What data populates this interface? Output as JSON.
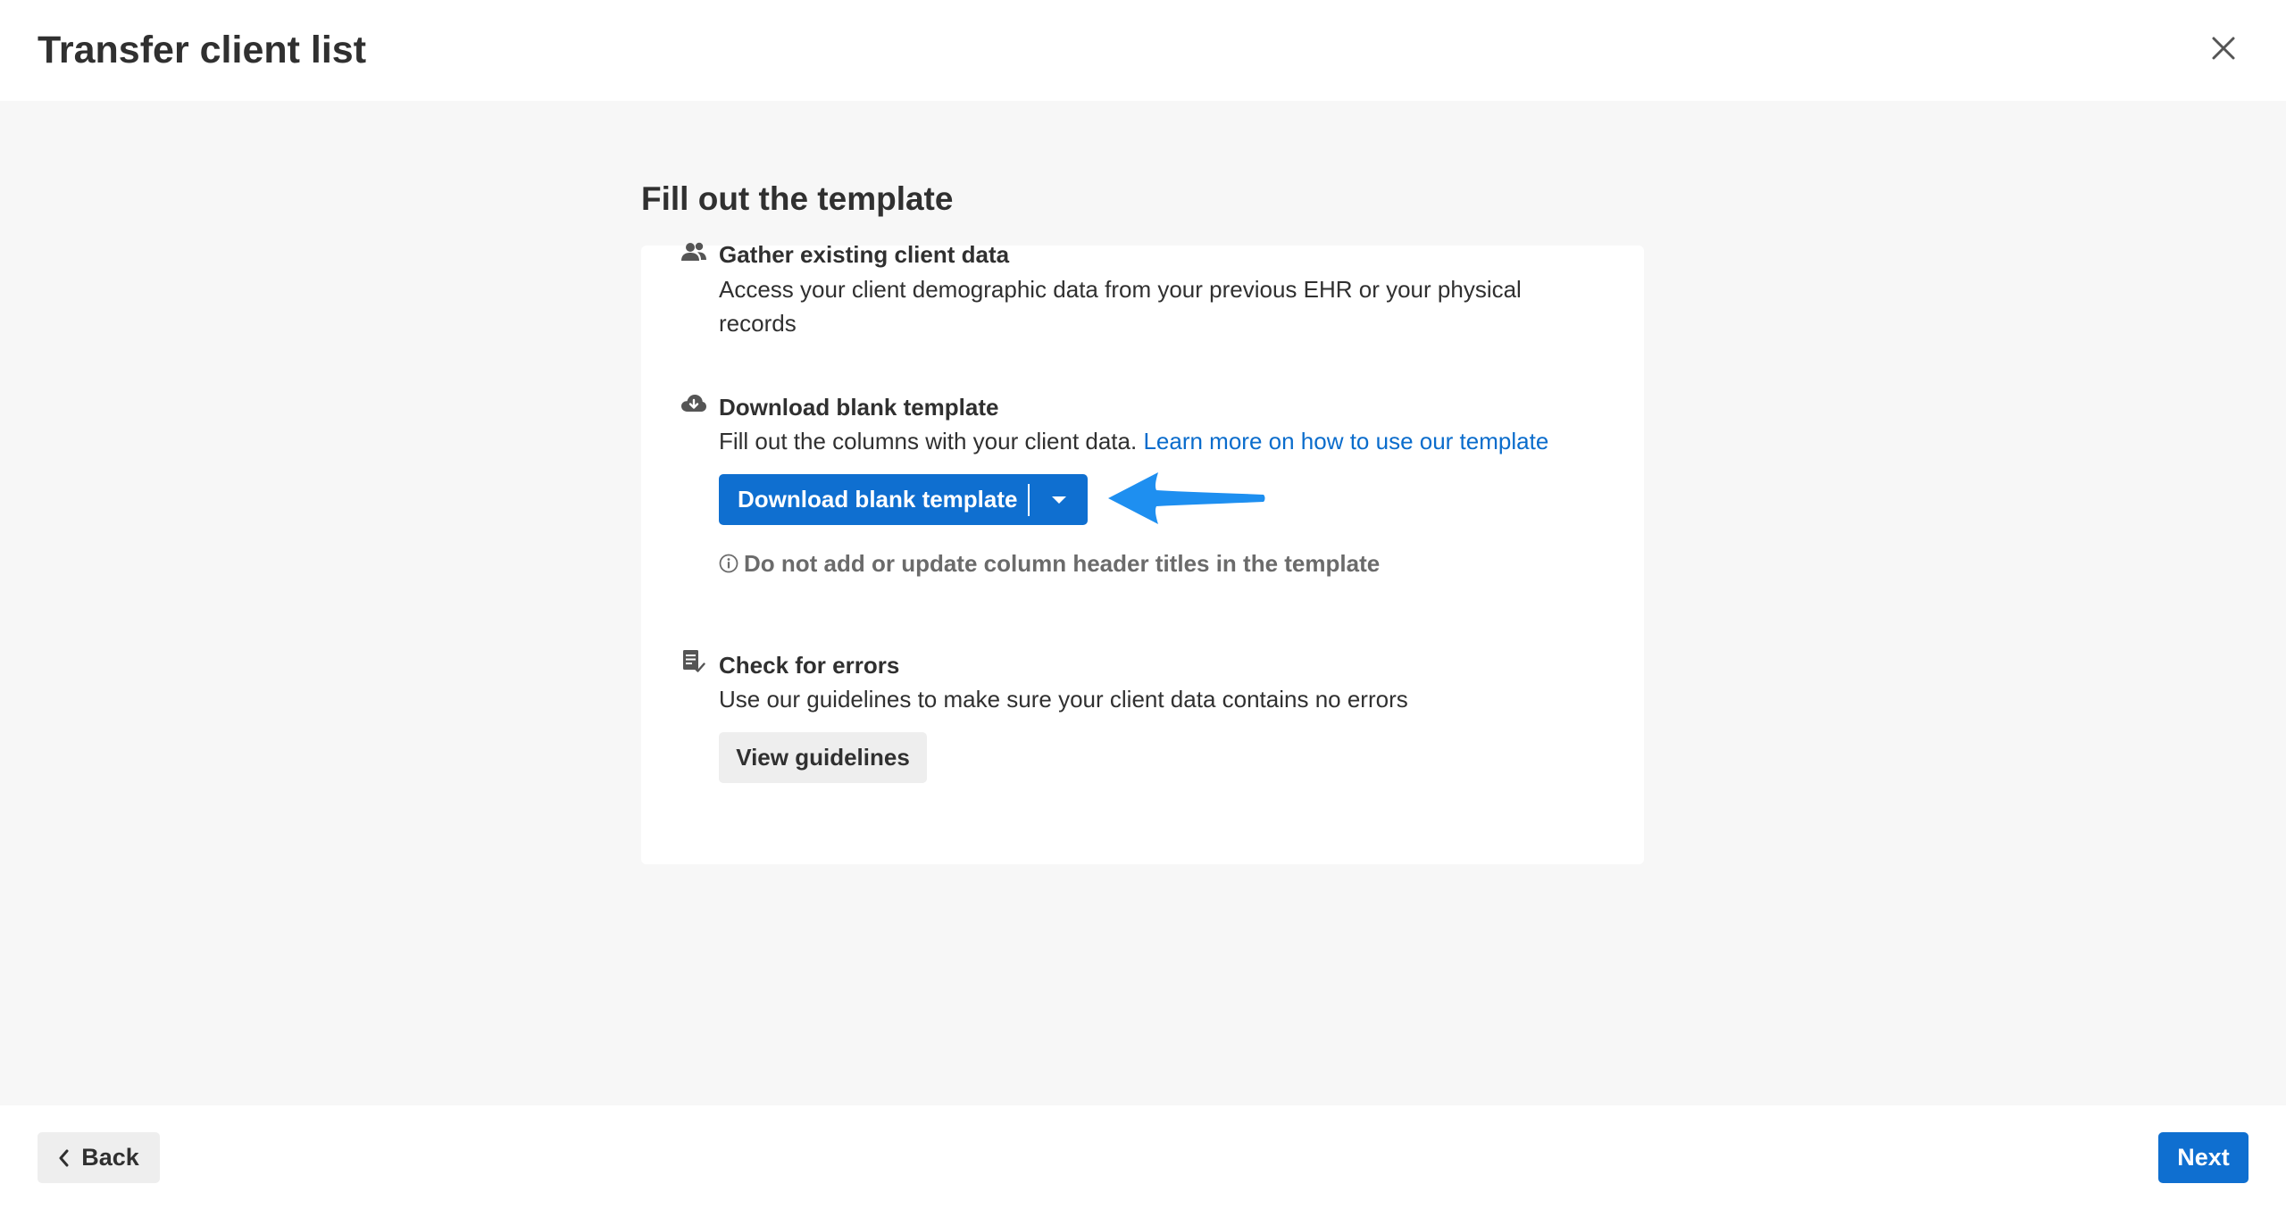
{
  "header": {
    "title": "Transfer client list",
    "close_icon": "close-icon"
  },
  "main": {
    "section_title": "Fill out the template",
    "steps": [
      {
        "icon": "people-icon",
        "title": "Gather existing client data",
        "description": "Access your client demographic data from your previous EHR or your physical records"
      },
      {
        "icon": "cloud-download-icon",
        "title": "Download blank template",
        "description": "Fill out the columns with your client data.",
        "link_text": "Learn more on how to use our template",
        "button_label": "Download blank template",
        "note": "Do not add or update column header titles in the template"
      },
      {
        "icon": "checklist-icon",
        "title": "Check for errors",
        "description": "Use our guidelines to make sure your client data contains no errors",
        "button_label": "View guidelines"
      }
    ]
  },
  "footer": {
    "back_label": "Back",
    "next_label": "Next"
  },
  "colors": {
    "primary": "#0f6fd0",
    "link": "#0a6ccc",
    "annotation_arrow": "#1e8ff0",
    "background": "#f7f7f7"
  }
}
